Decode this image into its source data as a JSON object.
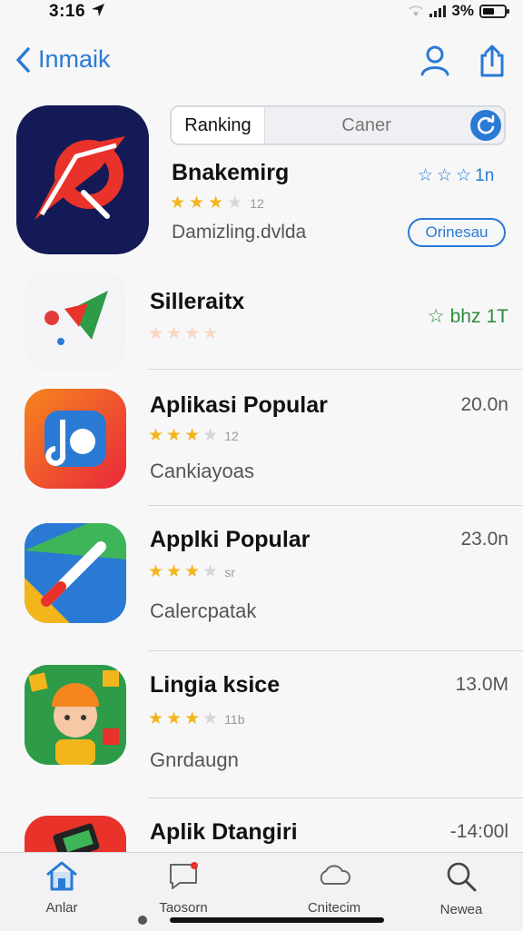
{
  "status_bar": {
    "time": "3:16",
    "battery": "3%"
  },
  "nav": {
    "back_label": "Inmaik"
  },
  "featured": {
    "segments": {
      "active": "Ranking",
      "inactive": "Caner"
    },
    "title": "Bnakemirg",
    "rating_text": "1n",
    "stars_note": "12",
    "subtitle": "Damizling.dvlda",
    "button": "Orinesau",
    "stars_filled": 3
  },
  "apps": [
    {
      "title": "Silleraitx",
      "subtitle": "",
      "meta": "1T",
      "meta_prefix": "bhz",
      "stars_filled": 0,
      "stars_note": ""
    },
    {
      "title": "Aplikasi Popular",
      "subtitle": "Cankiayoas",
      "meta": "20.0n",
      "stars_filled": 3,
      "stars_note": "12"
    },
    {
      "title": "Applki Popular",
      "subtitle": "Calercpatak",
      "meta": "23.0n",
      "stars_filled": 3,
      "stars_note": "sr"
    },
    {
      "title": "Lingia ksice",
      "subtitle": "Gnrdaugn",
      "meta": "13.0M",
      "stars_filled": 3,
      "stars_note": "11b"
    },
    {
      "title": "Aplik Dtangiri",
      "subtitle": "",
      "meta": "-14:00l",
      "stars_filled": 0,
      "stars_note": ""
    }
  ],
  "tabs": [
    {
      "label": "Anlar",
      "icon": "home-icon"
    },
    {
      "label": "Taosorn",
      "icon": "chat-icon"
    },
    {
      "label": "Cnitecim",
      "icon": "cloud-icon"
    },
    {
      "label": "Newea",
      "icon": "search-icon"
    }
  ],
  "colors": {
    "accent": "#2a7ad5",
    "star": "#f3b51c",
    "green": "#2e8b3c"
  }
}
